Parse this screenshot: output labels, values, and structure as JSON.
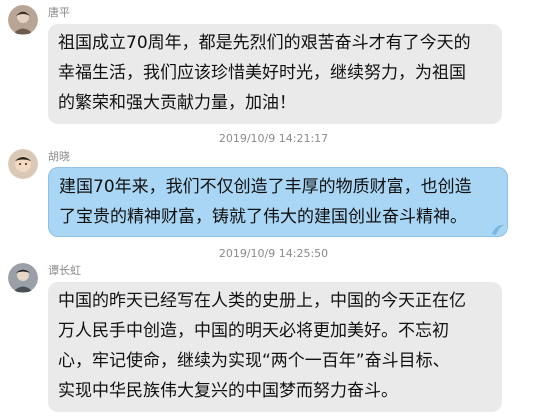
{
  "messages": [
    {
      "sender": "唐平",
      "avatar_icon": "user-avatar-icon",
      "style": "gray",
      "lines": [
        "祖国成立70周年，都是先烈们的艰苦奋斗才有了今天的",
        "幸福生活，我们应该珍惜美好时光，继续努力，为祖国",
        "的繁荣和强大贡献力量，加油！"
      ]
    },
    {
      "timestamp": "2019/10/9 14:21:17"
    },
    {
      "sender": "胡晓",
      "avatar_icon": "user-avatar-icon",
      "style": "blue",
      "lines": [
        "建国70年来，我们不仅创造了丰厚的物质财富，也创造",
        "了宝贵的精神财富，铸就了伟大的建国创业奋斗精神。"
      ]
    },
    {
      "timestamp": "2019/10/9 14:25:50"
    },
    {
      "sender": "谭长虹",
      "avatar_icon": "user-avatar-icon",
      "style": "gray",
      "lines": [
        "中国的昨天已经写在人类的史册上，中国的今天正在亿",
        "万人民手中创造，中国的明天必将更加美好。不忘初",
        "心，牢记使命，继续为实现“两个一百年”奋斗目标、",
        "实现中华民族伟大复兴的中国梦而努力奋斗。"
      ]
    }
  ],
  "colors": {
    "bubble_gray": "#eaeaea",
    "bubble_blue": "#a9d6f4",
    "meta_text": "#8a8a8a"
  }
}
